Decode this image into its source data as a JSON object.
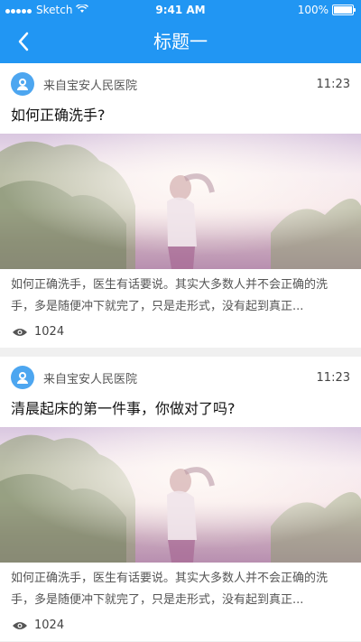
{
  "status": {
    "carrier": "Sketch",
    "time": "9:41 AM",
    "battery": "100%",
    "battery_level": 1.0
  },
  "nav": {
    "title": "标题一"
  },
  "articles": [
    {
      "source": "来自宝安人民医院",
      "time": "11:23",
      "title": "如何正确洗手?",
      "summary": "如何正确洗手，医生有话要说。其实大多数人并不会正确的洗手，多是随便冲下就完了，只是走形式，没有起到真正...",
      "views": "1024"
    },
    {
      "source": "来自宝安人民医院",
      "time": "11:23",
      "title": "清晨起床的第一件事，你做对了吗?",
      "summary": "如何正确洗手，医生有话要说。其实大多数人并不会正确的洗手，多是随便冲下就完了，只是走形式，没有起到真正...",
      "views": "1024"
    }
  ]
}
